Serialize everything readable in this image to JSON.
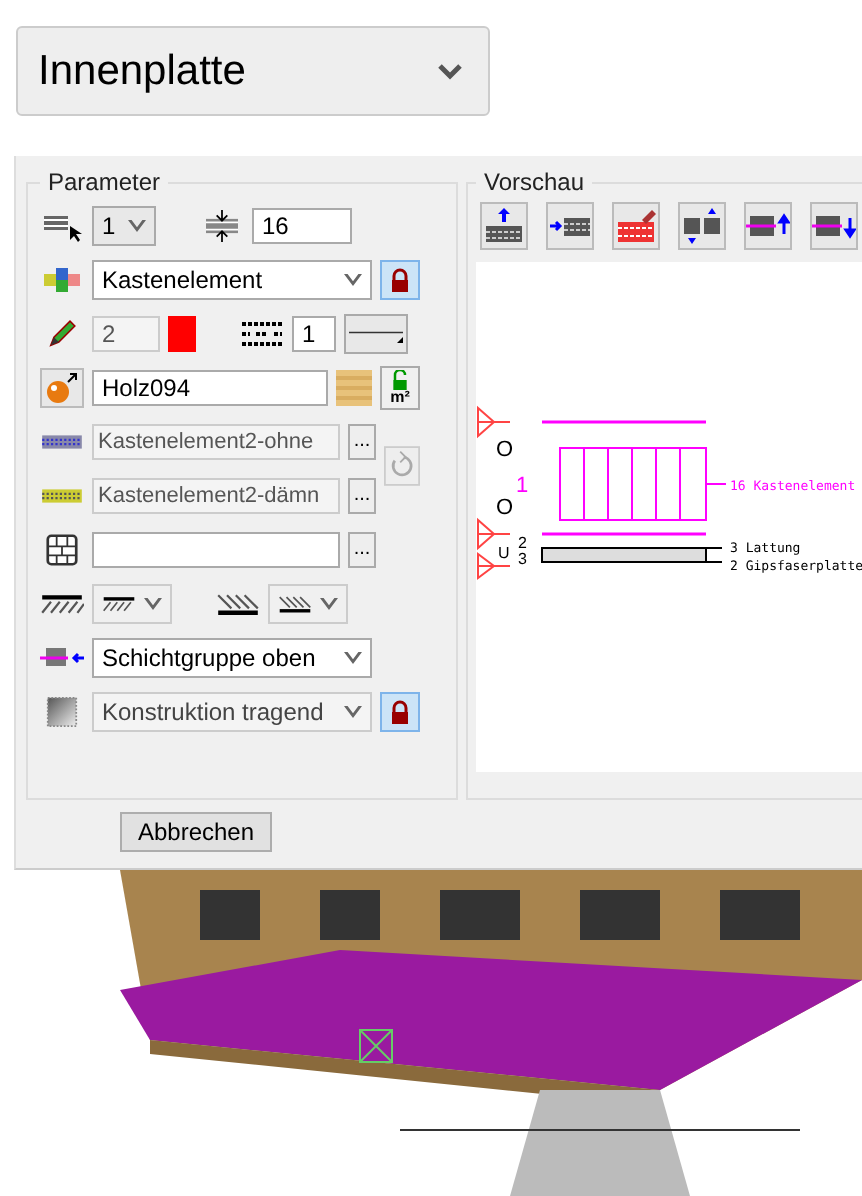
{
  "material_select": {
    "value": "Innenplatte"
  },
  "parameter": {
    "title": "Parameter",
    "layer_number": "1",
    "thickness": "16",
    "element": {
      "value": "Kastenelement",
      "locked": true
    },
    "pen": {
      "value": "2",
      "disabled": true,
      "color": "#ff0000"
    },
    "line_type": "1",
    "material": {
      "value": "Holz094",
      "locked": false,
      "unit": "m²"
    },
    "fills": [
      {
        "value": "Kastenelement2-ohne",
        "disabled": true,
        "browse": "..."
      },
      {
        "value": "Kastenelement2-dämn",
        "disabled": true,
        "browse": "..."
      }
    ],
    "brick": {
      "browse": "..."
    },
    "layer_group": {
      "value": "Schichtgruppe oben"
    },
    "construction": {
      "value": "Konstruktion tragend",
      "disabled": true,
      "locked": true
    }
  },
  "preview": {
    "title": "Vorschau",
    "side_labels": [
      "O",
      "O",
      "U"
    ],
    "row_numbers": [
      "1",
      "2",
      "3"
    ],
    "layers": [
      {
        "number": "16",
        "name": "Kastenelement",
        "color": "#ff00ff"
      },
      {
        "number": "3",
        "name": "Lattung",
        "color": "#000000"
      },
      {
        "number": "2",
        "name": "Gipsfaserplatte",
        "color": "#000000"
      }
    ]
  },
  "buttons": [
    {
      "label": "Abbrechen"
    }
  ]
}
